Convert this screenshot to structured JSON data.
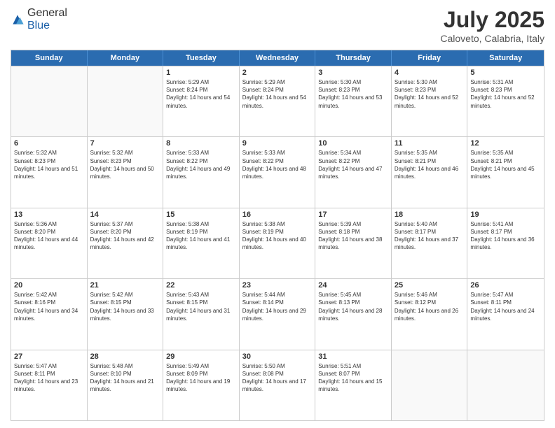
{
  "logo": {
    "general": "General",
    "blue": "Blue"
  },
  "header": {
    "month": "July 2025",
    "location": "Caloveto, Calabria, Italy"
  },
  "days_of_week": [
    "Sunday",
    "Monday",
    "Tuesday",
    "Wednesday",
    "Thursday",
    "Friday",
    "Saturday"
  ],
  "weeks": [
    [
      {
        "day": null
      },
      {
        "day": null
      },
      {
        "day": "1",
        "sunrise": "5:29 AM",
        "sunset": "8:24 PM",
        "daylight": "14 hours and 54 minutes."
      },
      {
        "day": "2",
        "sunrise": "5:29 AM",
        "sunset": "8:24 PM",
        "daylight": "14 hours and 54 minutes."
      },
      {
        "day": "3",
        "sunrise": "5:30 AM",
        "sunset": "8:23 PM",
        "daylight": "14 hours and 53 minutes."
      },
      {
        "day": "4",
        "sunrise": "5:30 AM",
        "sunset": "8:23 PM",
        "daylight": "14 hours and 52 minutes."
      },
      {
        "day": "5",
        "sunrise": "5:31 AM",
        "sunset": "8:23 PM",
        "daylight": "14 hours and 52 minutes."
      }
    ],
    [
      {
        "day": "6",
        "sunrise": "5:32 AM",
        "sunset": "8:23 PM",
        "daylight": "14 hours and 51 minutes."
      },
      {
        "day": "7",
        "sunrise": "5:32 AM",
        "sunset": "8:23 PM",
        "daylight": "14 hours and 50 minutes."
      },
      {
        "day": "8",
        "sunrise": "5:33 AM",
        "sunset": "8:22 PM",
        "daylight": "14 hours and 49 minutes."
      },
      {
        "day": "9",
        "sunrise": "5:33 AM",
        "sunset": "8:22 PM",
        "daylight": "14 hours and 48 minutes."
      },
      {
        "day": "10",
        "sunrise": "5:34 AM",
        "sunset": "8:22 PM",
        "daylight": "14 hours and 47 minutes."
      },
      {
        "day": "11",
        "sunrise": "5:35 AM",
        "sunset": "8:21 PM",
        "daylight": "14 hours and 46 minutes."
      },
      {
        "day": "12",
        "sunrise": "5:35 AM",
        "sunset": "8:21 PM",
        "daylight": "14 hours and 45 minutes."
      }
    ],
    [
      {
        "day": "13",
        "sunrise": "5:36 AM",
        "sunset": "8:20 PM",
        "daylight": "14 hours and 44 minutes."
      },
      {
        "day": "14",
        "sunrise": "5:37 AM",
        "sunset": "8:20 PM",
        "daylight": "14 hours and 42 minutes."
      },
      {
        "day": "15",
        "sunrise": "5:38 AM",
        "sunset": "8:19 PM",
        "daylight": "14 hours and 41 minutes."
      },
      {
        "day": "16",
        "sunrise": "5:38 AM",
        "sunset": "8:19 PM",
        "daylight": "14 hours and 40 minutes."
      },
      {
        "day": "17",
        "sunrise": "5:39 AM",
        "sunset": "8:18 PM",
        "daylight": "14 hours and 38 minutes."
      },
      {
        "day": "18",
        "sunrise": "5:40 AM",
        "sunset": "8:17 PM",
        "daylight": "14 hours and 37 minutes."
      },
      {
        "day": "19",
        "sunrise": "5:41 AM",
        "sunset": "8:17 PM",
        "daylight": "14 hours and 36 minutes."
      }
    ],
    [
      {
        "day": "20",
        "sunrise": "5:42 AM",
        "sunset": "8:16 PM",
        "daylight": "14 hours and 34 minutes."
      },
      {
        "day": "21",
        "sunrise": "5:42 AM",
        "sunset": "8:15 PM",
        "daylight": "14 hours and 33 minutes."
      },
      {
        "day": "22",
        "sunrise": "5:43 AM",
        "sunset": "8:15 PM",
        "daylight": "14 hours and 31 minutes."
      },
      {
        "day": "23",
        "sunrise": "5:44 AM",
        "sunset": "8:14 PM",
        "daylight": "14 hours and 29 minutes."
      },
      {
        "day": "24",
        "sunrise": "5:45 AM",
        "sunset": "8:13 PM",
        "daylight": "14 hours and 28 minutes."
      },
      {
        "day": "25",
        "sunrise": "5:46 AM",
        "sunset": "8:12 PM",
        "daylight": "14 hours and 26 minutes."
      },
      {
        "day": "26",
        "sunrise": "5:47 AM",
        "sunset": "8:11 PM",
        "daylight": "14 hours and 24 minutes."
      }
    ],
    [
      {
        "day": "27",
        "sunrise": "5:47 AM",
        "sunset": "8:11 PM",
        "daylight": "14 hours and 23 minutes."
      },
      {
        "day": "28",
        "sunrise": "5:48 AM",
        "sunset": "8:10 PM",
        "daylight": "14 hours and 21 minutes."
      },
      {
        "day": "29",
        "sunrise": "5:49 AM",
        "sunset": "8:09 PM",
        "daylight": "14 hours and 19 minutes."
      },
      {
        "day": "30",
        "sunrise": "5:50 AM",
        "sunset": "8:08 PM",
        "daylight": "14 hours and 17 minutes."
      },
      {
        "day": "31",
        "sunrise": "5:51 AM",
        "sunset": "8:07 PM",
        "daylight": "14 hours and 15 minutes."
      },
      {
        "day": null
      },
      {
        "day": null
      }
    ]
  ]
}
